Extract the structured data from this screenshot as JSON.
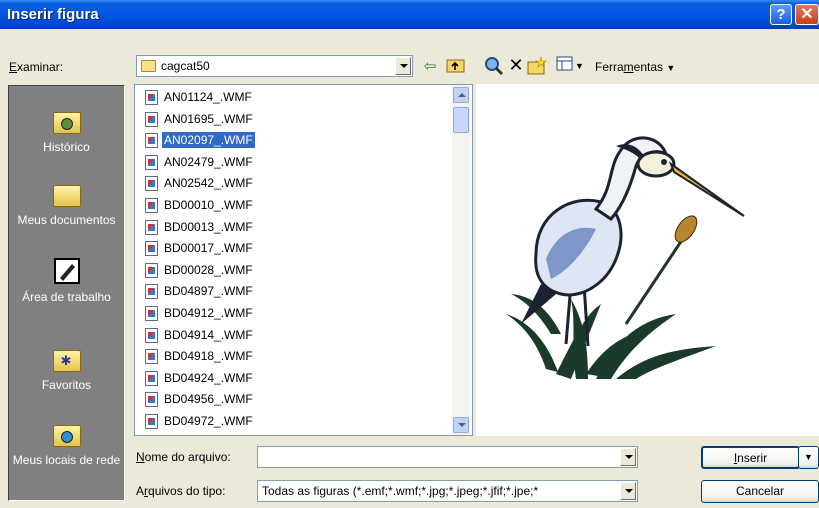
{
  "window": {
    "title": "Inserir figura"
  },
  "toolbar": {
    "lookin_label": "Examinar:",
    "lookin_accel": "E",
    "lookin_rest": "xaminar:",
    "folder": "cagcat50",
    "tools_pre": "Ferra",
    "tools_accel": "m",
    "tools_post": "entas"
  },
  "places": [
    {
      "label": "Histórico",
      "icon": "history-icon"
    },
    {
      "label": "Meus documentos",
      "icon": "my-documents-icon"
    },
    {
      "label": "Área de trabalho",
      "icon": "desktop-icon"
    },
    {
      "label": "Favoritos",
      "icon": "favorites-icon"
    },
    {
      "label": "Meus locais de rede",
      "icon": "network-places-icon"
    }
  ],
  "files": [
    "AN01124_.WMF",
    "AN01695_.WMF",
    "AN02097_.WMF",
    "AN02479_.WMF",
    "AN02542_.WMF",
    "BD00010_.WMF",
    "BD00013_.WMF",
    "BD00017_.WMF",
    "BD00028_.WMF",
    "BD04897_.WMF",
    "BD04912_.WMF",
    "BD04914_.WMF",
    "BD04918_.WMF",
    "BD04924_.WMF",
    "BD04956_.WMF",
    "BD04972_.WMF"
  ],
  "selected_file": "AN02097_.WMF",
  "form": {
    "filename_accel": "N",
    "filename_rest": "ome do arquivo:",
    "filename_value": "",
    "filetype_pre": "A",
    "filetype_accel": "r",
    "filetype_rest": "quivos do tipo:",
    "filetype_value": "Todas as figuras (*.emf;*.wmf;*.jpg;*.jpeg;*.jfif;*.jpe;*"
  },
  "buttons": {
    "insert_accel": "I",
    "insert_rest": "nserir",
    "cancel": "Cancelar"
  },
  "colors": {
    "titlebar": "#0055E5",
    "selection": "#316AC5",
    "places_bg": "#808080"
  }
}
